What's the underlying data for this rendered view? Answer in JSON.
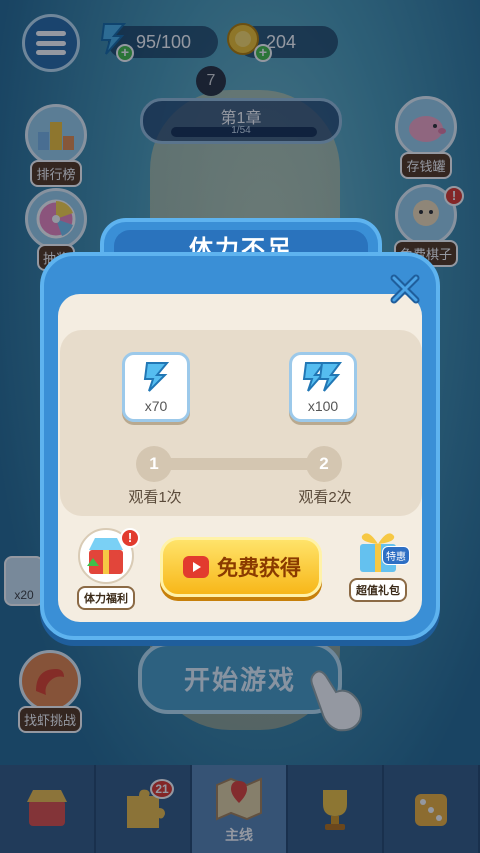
{
  "top_bar": {
    "energy": "95/100",
    "coins": "204"
  },
  "chapter": {
    "title": "第1章",
    "progress_text": "1/54"
  },
  "side_buttons": {
    "leaderboard": "排行榜",
    "lottery": "抽奖",
    "piggy_bank": "存钱罐",
    "free_chess": "免费棋子",
    "shrimp_challenge": "找虾挑战"
  },
  "background_fragments": {
    "left_value": "x20",
    "map_dot": "7"
  },
  "dialog": {
    "title": "体力不足",
    "rewards": [
      {
        "value": "x70",
        "watch_label": "观看1次",
        "step": "1"
      },
      {
        "value": "x100",
        "watch_label": "观看2次",
        "step": "2"
      }
    ],
    "stamina_welfare": "体力福利",
    "free_get": "免费获得",
    "gift_pack": "超值礼包",
    "gift_tag": "特惠"
  },
  "start_button": "开始游戏",
  "bottom_nav": {
    "tabs": [
      {
        "label": "",
        "icon": "shop-icon"
      },
      {
        "label": "",
        "icon": "puzzle-icon",
        "badge": "21"
      },
      {
        "label": "主线",
        "icon": "map-icon"
      },
      {
        "label": "",
        "icon": "trophy-icon"
      },
      {
        "label": "",
        "icon": "dice-icon"
      }
    ]
  },
  "colors": {
    "dialog_blue": "#3a8fd6",
    "button_yellow": "#f7b719",
    "badge_red": "#e23b2e"
  }
}
